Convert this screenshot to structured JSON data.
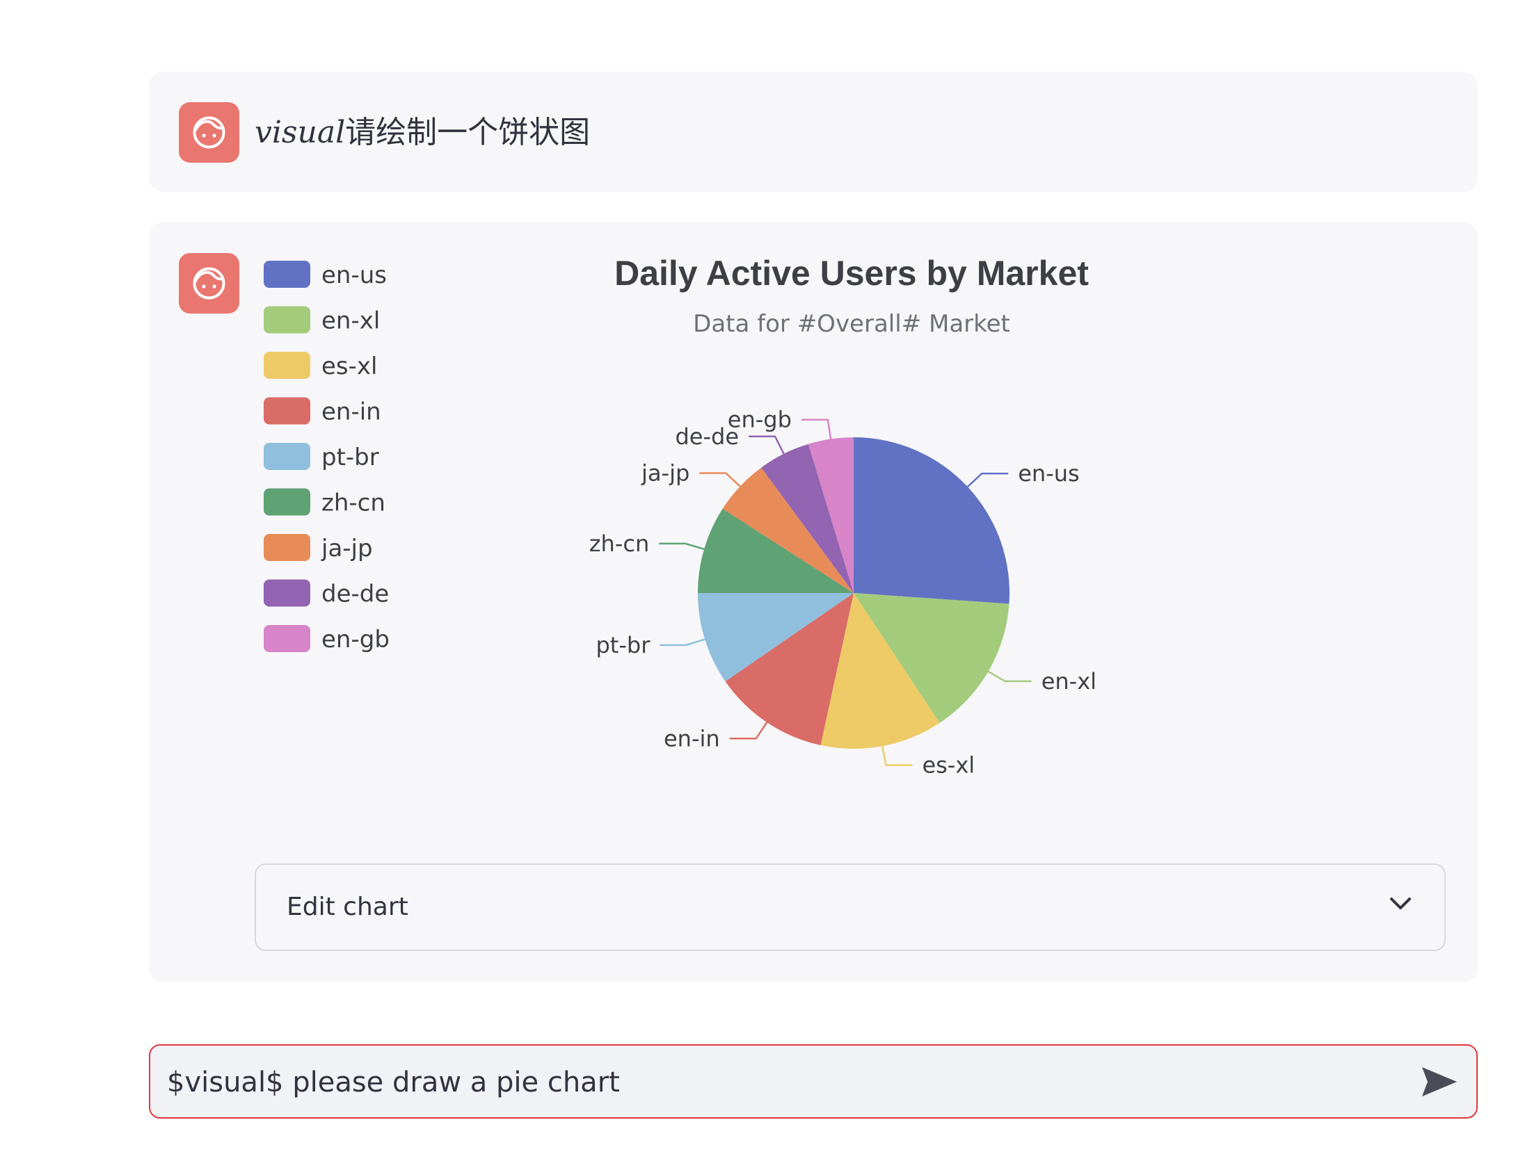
{
  "prompt": {
    "visual_word": "visual",
    "text": "请绘制一个饼状图"
  },
  "chart_data": {
    "type": "pie",
    "title": "Daily Active Users by Market",
    "subtitle": "Data for #Overall# Market",
    "legend_position": "top-left",
    "slices": [
      {
        "name": "en-us",
        "value": 26.1,
        "color": "#6172c4"
      },
      {
        "name": "en-xl",
        "value": 14.6,
        "color": "#a3cb7c"
      },
      {
        "name": "es-xl",
        "value": 12.7,
        "color": "#eeca67"
      },
      {
        "name": "en-in",
        "value": 12.0,
        "color": "#d96c66"
      },
      {
        "name": "pt-br",
        "value": 9.6,
        "color": "#8fbfdd"
      },
      {
        "name": "zh-cn",
        "value": 9.1,
        "color": "#5fa274"
      },
      {
        "name": "ja-jp",
        "value": 5.8,
        "color": "#e78b58"
      },
      {
        "name": "de-de",
        "value": 5.4,
        "color": "#9264b2"
      },
      {
        "name": "en-gb",
        "value": 4.7,
        "color": "#d784c8"
      }
    ]
  },
  "edit_chart": {
    "label": "Edit chart"
  },
  "chat_input": {
    "value": "$visual$ please draw a pie chart"
  },
  "icons": {
    "avatar": "face-icon",
    "expand": "chevron-down-icon",
    "send": "send-icon"
  }
}
